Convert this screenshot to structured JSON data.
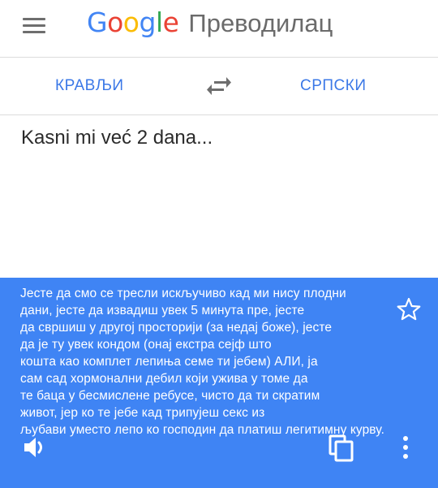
{
  "header": {
    "logo": {
      "letters": [
        "G",
        "o",
        "o",
        "g",
        "l",
        "e"
      ],
      "colors": [
        "#4285f4",
        "#ea4335",
        "#fbbc05",
        "#4285f4",
        "#34a853",
        "#ea4335"
      ]
    },
    "app_name": "Преводилац",
    "menu_icon": "hamburger-menu-icon"
  },
  "languages": {
    "source": "КРАВЉИ",
    "target": "СРПСКИ",
    "swap_icon": "swap-arrows-icon",
    "accent_color": "#3b78e7"
  },
  "input": {
    "text": "Kasni mi već 2 dana..."
  },
  "result": {
    "background_color": "#3f84f4",
    "lines": [
      "Јесте да смо се тресли искључиво кад ми нису плодни",
      "дани, јесте да извадиш увек 5 минута пре, јесте",
      "да свршиш у другој просторији (за недај боже), јесте",
      "да је ту увек кондом (онај екстра сејф што",
      "кошта као комплет лепиња семе ти јебем) АЛИ, ја",
      "сам сад хормонални дебил који ужива у томе да",
      "те баца у бесмислене ребусе, чисто да ти скратим",
      "живот, јер ко те јебе кад трипујеш секс из",
      "љубави уместо лепо ко господин да платиш легитимну курву."
    ],
    "icons": {
      "star": "star-outline-icon",
      "speaker": "speaker-icon",
      "copy": "copy-icon",
      "more": "more-vertical-icon"
    }
  }
}
